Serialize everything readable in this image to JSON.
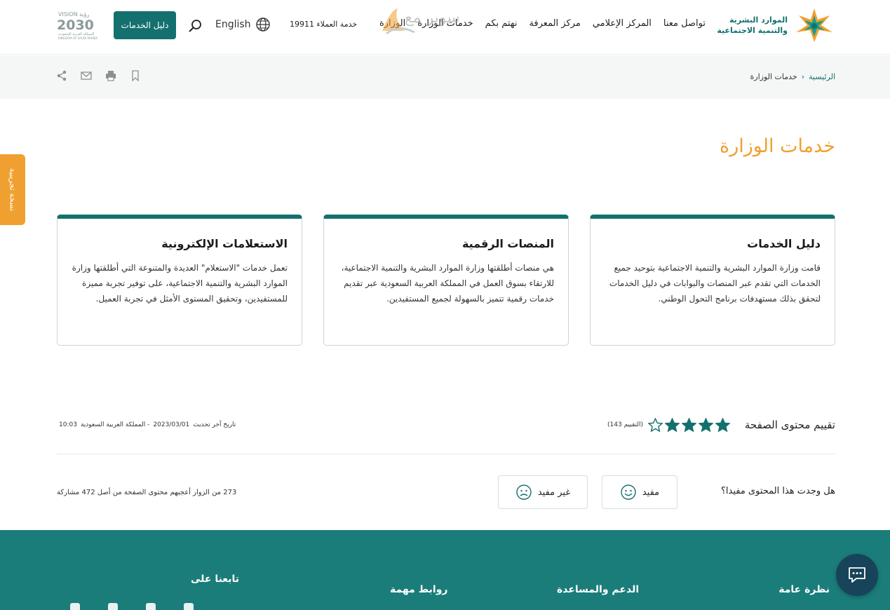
{
  "colors": {
    "primary": "#14706e",
    "accent": "#f0a030",
    "footer": "#1a7d7a",
    "chat": "#17445a"
  },
  "header": {
    "logo_line1": "الموارد البشرية",
    "logo_line2": "والتنمية الاجتماعية",
    "nav": [
      "الوزارة",
      "خدمات الوزارة",
      "نهتم بكم",
      "مركز المعرفة",
      "المركز الإعلامي",
      "تواصل معنا"
    ],
    "brand_overlay": "سوبر مع",
    "hotline": "خدمة العملاء 19911",
    "language": "English",
    "guide_button": "دليل الخدمات",
    "vision_top": "VISION رؤية",
    "vision_year": "2030",
    "vision_sub": "المملكة العربية السعودية",
    "vision_en": "KINGDOM OF SAUDI ARABIA"
  },
  "breadcrumb": {
    "home": "الرئيسية",
    "separator": "‹",
    "current": "خدمات الوزارة"
  },
  "tools": [
    "bookmark-icon",
    "print-icon",
    "mail-icon",
    "share-icon"
  ],
  "side_tab": "نسخة تجريبية",
  "page_title": "خدمات الوزارة",
  "cards": [
    {
      "title": "دليل الخدمات",
      "text": "قامت وزارة الموارد البشرية والتنمية الاجتماعية بتوحيد جميع الخدمات التي تقدم عبر المنصات والبوابات في دليل الخدمات لتحقق بذلك مستهدفات برنامج التحول الوطني."
    },
    {
      "title": "المنصات الرقمية",
      "text": "هي منصات أطلقتها وزارة الموارد البشرية والتنمية الاجتماعية، للارتقاء بسوق العمل في المملكة العربية السعودية عبر تقديم خدمات رقمية تتميز بالسهولة لجميع المستفيدين."
    },
    {
      "title": "الاستعلامات الإلكترونية",
      "text": "تعمل خدمات \"الاستعلام\" العديدة والمتنوعة التي أطلقتها وزارة الموارد البشرية والتنمية الاجتماعية، على توفير تجربة مميزة للمستفيدين، وتحقيق المستوى الأمثل في تجربة العميل."
    }
  ],
  "rating": {
    "label": "تقييم محتوى الصفحة",
    "stars_filled": 4,
    "stars_total": 5,
    "count_text": "(التقييم 143)",
    "updated_label": "تاريخ آخر تحديث",
    "updated_date": "2023/03/01",
    "updated_zone": "- المملكة العربية السعودية",
    "updated_time": "10:03"
  },
  "feedback": {
    "question": "هل وجدت هذا المحتوى مفيدا؟",
    "yes": "مفيد",
    "no": "غير مفيد",
    "stats": "273 من الزوار أعجبهم محتوى الصفحة من أصل 472 مشاركة"
  },
  "footer": {
    "overview": "نظرة عامة",
    "support": "الدعم والمساعدة",
    "links": "روابط مهمة",
    "follow": "تابعنا على"
  }
}
